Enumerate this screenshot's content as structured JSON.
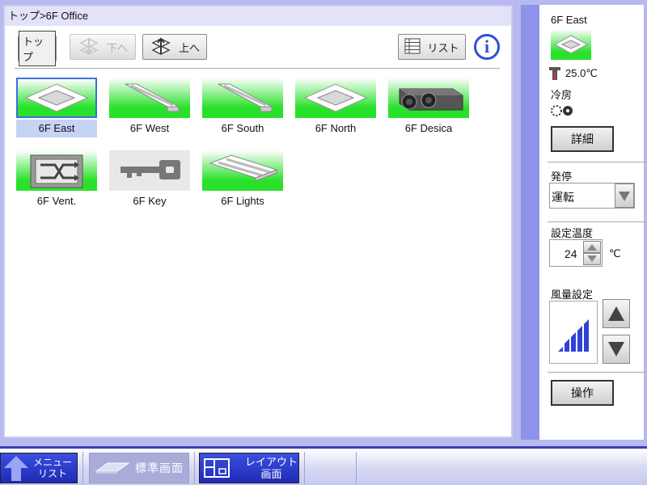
{
  "breadcrumb": "トップ>6F Office",
  "toolbar": {
    "top_label": "トップ",
    "down_label": "下へ",
    "up_label": "上へ",
    "list_label": "リスト",
    "info_label": "i"
  },
  "devices": [
    {
      "label": "6F East",
      "icon": "cassette-ac-icon",
      "selected": true
    },
    {
      "label": "6F West",
      "icon": "fluorescent-light-icon"
    },
    {
      "label": "6F South",
      "icon": "fluorescent-light-icon"
    },
    {
      "label": "6F North",
      "icon": "cassette-ac-icon"
    },
    {
      "label": "6F Desica",
      "icon": "desiccant-unit-icon"
    },
    {
      "label": "6F Vent.",
      "icon": "ventilation-icon"
    },
    {
      "label": "6F Key",
      "icon": "key-icon"
    },
    {
      "label": "6F Lights",
      "icon": "fluorescent-light-icon"
    }
  ],
  "side": {
    "device_name": "6F East",
    "temperature": "25.0℃",
    "mode": "冷房",
    "detail_label": "詳細",
    "onoff_title": "発停",
    "onoff_value": "運転",
    "setpoint_title": "設定温度",
    "setpoint_value": "24",
    "setpoint_unit": "℃",
    "fan_title": "風量設定",
    "operate_label": "操作"
  },
  "bottom": {
    "menu_line1": "メニュー",
    "menu_line2": "リスト",
    "std_label": "標準画面",
    "layout_line1": "レイアウト",
    "layout_line2": "画面"
  },
  "colors": {
    "accent": "#2d50d9",
    "thumb_green": "#29e12b",
    "panel_bg": "#b7b9ef"
  }
}
